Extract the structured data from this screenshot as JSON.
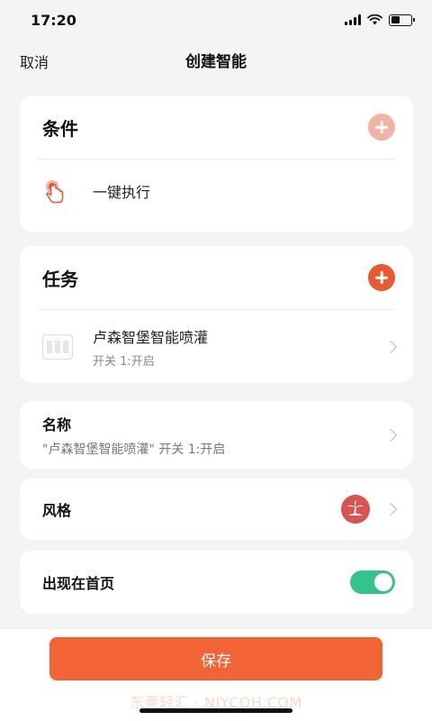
{
  "status_bar": {
    "time": "17:20"
  },
  "nav": {
    "cancel_label": "取消",
    "title": "创建智能"
  },
  "conditions": {
    "title": "条件",
    "items": [
      {
        "label": "一键执行",
        "icon": "tap-hand-icon"
      }
    ]
  },
  "tasks": {
    "title": "任务",
    "items": [
      {
        "title": "卢森智堡智能喷灌",
        "subtitle": "开关 1:开启",
        "icon": "device-icon"
      }
    ]
  },
  "name_row": {
    "label": "名称",
    "value": "\"卢森智堡智能喷灌\" 开关 1:开启"
  },
  "style_row": {
    "label": "风格",
    "icon": "island-palm-icon"
  },
  "home_row": {
    "label": "出现在首页",
    "enabled": true
  },
  "save_label": "保存",
  "watermark": "东莞轻汇 · NIYCOH.COM",
  "colors": {
    "accent": "#f26435",
    "add_button": "#ea5a32",
    "add_button_disabled": "#f3b3a3",
    "toggle_on": "#34c48b",
    "style_badge": "#d9534f",
    "background": "#f4f4f4"
  }
}
